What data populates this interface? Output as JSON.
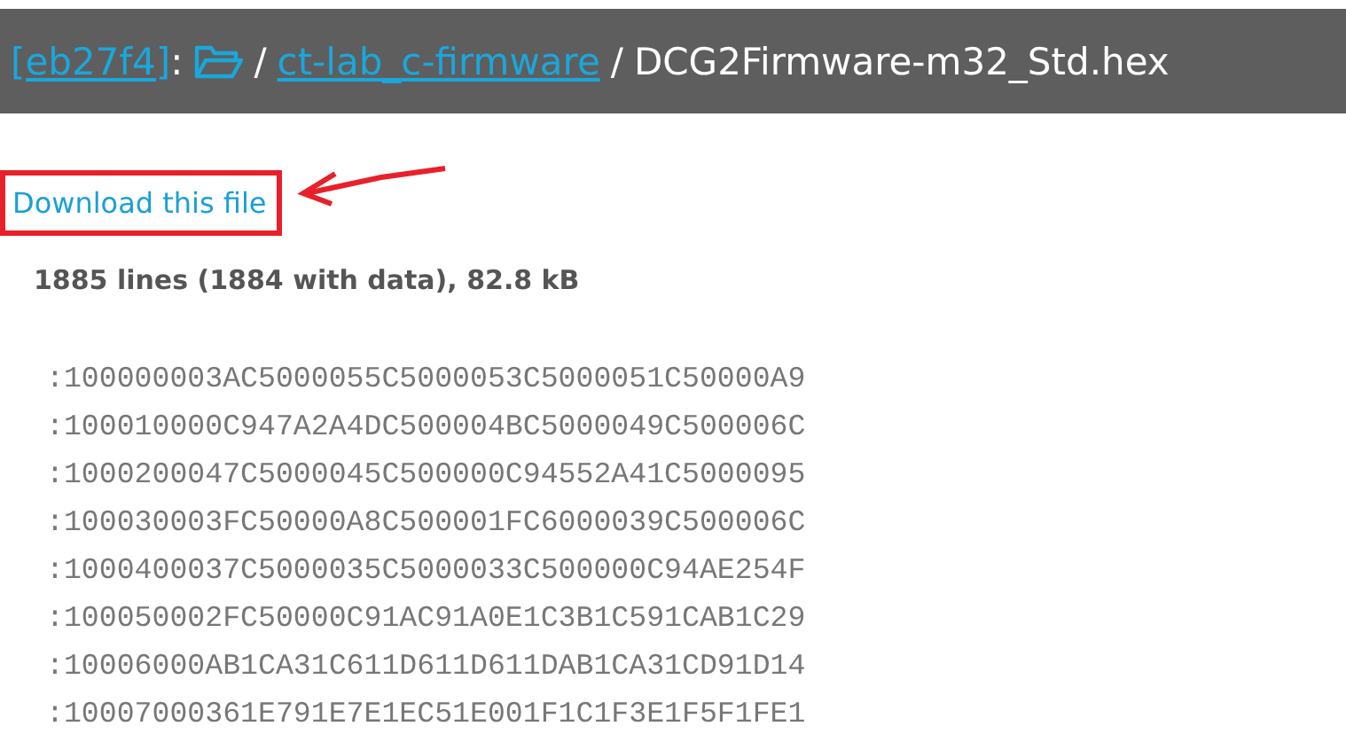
{
  "breadcrumb": {
    "commit": "[eb27f4]",
    "separator_1": ":",
    "separator_2": "/",
    "folder": "ct-lab_c-firmware",
    "separator_3": "/",
    "file": "DCG2Firmware-m32_Std.hex"
  },
  "download_link": "Download this file",
  "file_info": "1885 lines (1884 with data), 82.8 kB",
  "lines": [
    ":100000003AC5000055C5000053C5000051C50000A9",
    ":100010000C947A2A4DC500004BC5000049C500006C",
    ":1000200047C5000045C500000C94552A41C5000095",
    ":100030003FC50000A8C500001FC6000039C500006C",
    ":1000400037C5000035C5000033C500000C94AE254F",
    ":100050002FC50000C91AC91A0E1C3B1C591CAB1C29",
    ":10006000AB1CA31C611D611D611DAB1CA31CD91D14",
    ":10007000361E791E7E1EC51E001F1C1F3E1F5F1FE1"
  ]
}
